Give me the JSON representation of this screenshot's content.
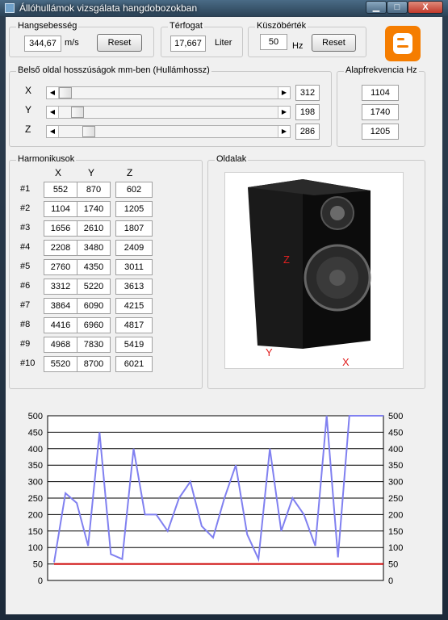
{
  "window": {
    "title": "Állóhullámok vizsgálata hangdobozokban",
    "min_glyph": "▁",
    "max_glyph": "□",
    "close_glyph": "X"
  },
  "sound_speed": {
    "label": "Hangsebesség",
    "value": "344,67",
    "unit": "m/s",
    "reset_label": "Reset"
  },
  "volume": {
    "label": "Térfogat",
    "value": "17,667",
    "unit": "Liter"
  },
  "threshold": {
    "label": "Küszöbérték",
    "value": "50",
    "unit": "Hz",
    "reset_label": "Reset"
  },
  "inner_dims": {
    "label": "Belső oldal hosszúságok mm-ben (Hullámhossz)",
    "rows": [
      {
        "axis": "X",
        "value": "312"
      },
      {
        "axis": "Y",
        "value": "198"
      },
      {
        "axis": "Z",
        "value": "286"
      }
    ],
    "arrow_left": "◀",
    "arrow_right": "▶"
  },
  "fundamental": {
    "label": "Alapfrekvencia Hz",
    "values": [
      "1104",
      "1740",
      "1205"
    ]
  },
  "harmonics": {
    "label": "Harmonikusok",
    "headers": [
      "X",
      "Y",
      "Z"
    ],
    "rows": [
      {
        "n": "#1",
        "x": "552",
        "y": "870",
        "z": "602"
      },
      {
        "n": "#2",
        "x": "1104",
        "y": "1740",
        "z": "1205"
      },
      {
        "n": "#3",
        "x": "1656",
        "y": "2610",
        "z": "1807"
      },
      {
        "n": "#4",
        "x": "2208",
        "y": "3480",
        "z": "2409"
      },
      {
        "n": "#5",
        "x": "2760",
        "y": "4350",
        "z": "3011"
      },
      {
        "n": "#6",
        "x": "3312",
        "y": "5220",
        "z": "3613"
      },
      {
        "n": "#7",
        "x": "3864",
        "y": "6090",
        "z": "4215"
      },
      {
        "n": "#8",
        "x": "4416",
        "y": "6960",
        "z": "4817"
      },
      {
        "n": "#9",
        "x": "4968",
        "y": "7830",
        "z": "5419"
      },
      {
        "n": "#10",
        "x": "5520",
        "y": "8700",
        "z": "6021"
      }
    ]
  },
  "sides": {
    "label": "Oldalak",
    "z_label": "Z",
    "y_label": "Y",
    "x_label": "X"
  },
  "colors": {
    "series": "#8080f0",
    "threshold": "#cc0000",
    "accent": "#f57d00"
  },
  "chart_data": {
    "type": "line",
    "title": "",
    "xlabel": "",
    "ylabel": "",
    "ylim": [
      0,
      500
    ],
    "yticks": [
      0,
      50,
      100,
      150,
      200,
      250,
      300,
      350,
      400,
      450,
      500
    ],
    "grid": true,
    "series": [
      {
        "values": [
          55,
          265,
          235,
          105,
          450,
          80,
          65,
          400,
          200,
          200,
          150,
          250,
          300,
          165,
          130,
          250,
          350,
          140,
          65,
          400,
          150,
          250,
          200,
          105,
          500,
          70,
          500,
          500,
          500,
          500
        ]
      },
      {
        "values": [
          50,
          50,
          50,
          50,
          50,
          50,
          50,
          50,
          50,
          50,
          50,
          50,
          50,
          50,
          50,
          50,
          50,
          50,
          50,
          50,
          50,
          50,
          50,
          50,
          50,
          50,
          50,
          50,
          50,
          50
        ]
      }
    ]
  }
}
